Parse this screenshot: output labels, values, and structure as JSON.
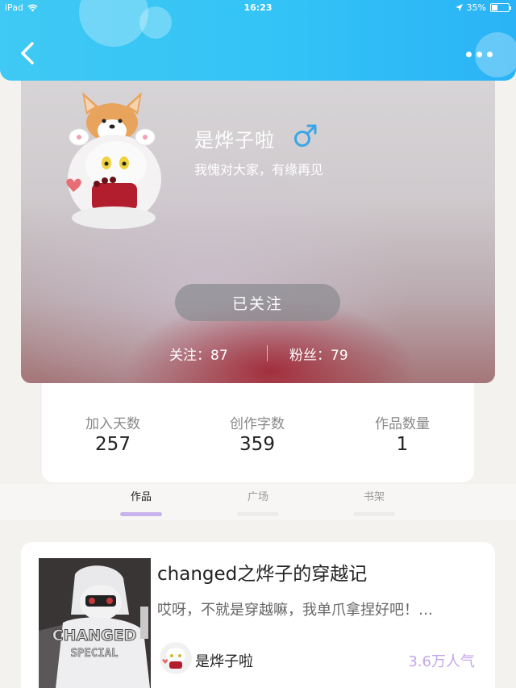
{
  "status_bar": {
    "device": "iPad",
    "time": "16:23",
    "battery": "35%"
  },
  "header": {
    "back_icon": "chevron-left-icon",
    "more_icon": "ellipsis-icon"
  },
  "profile": {
    "name": "是烨子啦",
    "gender_icon": "male-icon",
    "bio": "我愧对大家，有缘再见",
    "follow_button": "已关注",
    "following": "关注：87",
    "fans": "粉丝：79"
  },
  "stats": [
    {
      "label": "加入天数",
      "value": "257"
    },
    {
      "label": "创作字数",
      "value": "359"
    },
    {
      "label": "作品数量",
      "value": "1"
    }
  ],
  "tabs": [
    {
      "label": "作品",
      "active": true
    },
    {
      "label": "广场",
      "active": false
    },
    {
      "label": "书架",
      "active": false
    }
  ],
  "work": {
    "title": "changed之烨子的穿越记",
    "description": "哎呀，不就是穿越嘛，我单爪拿捏好吧！…",
    "cover_text": "CHANGED",
    "cover_subtext": "SPECIAL",
    "author": "是烨子啦",
    "popularity": "3.6万人气"
  },
  "colors": {
    "header": "#33c3f6",
    "accent": "#c4a6ea",
    "gender": "#3aa6e8"
  }
}
